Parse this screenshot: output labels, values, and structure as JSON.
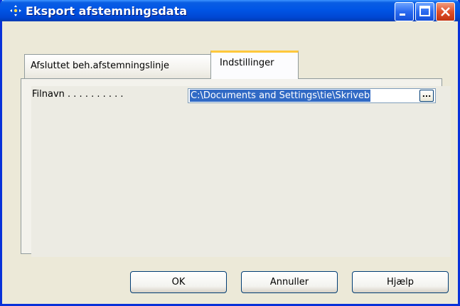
{
  "window": {
    "title": "Eksport afstemningsdata",
    "icon": "move-arrows-icon",
    "controls": [
      "minimize-icon",
      "maximize-icon",
      "close-icon"
    ]
  },
  "tabs": [
    {
      "label": "Afsluttet beh.afstemningslinje",
      "active": false
    },
    {
      "label": "Indstillinger",
      "active": true
    }
  ],
  "form": {
    "filename_label": "Filnavn . . . . . . . . . .",
    "filename_value": "C:\\Documents and Settings\\tie\\Skriveb",
    "browse_label": "..."
  },
  "buttons": {
    "ok": "OK",
    "cancel": "Annuller",
    "help": "Hjælp"
  },
  "colors": {
    "titlebar": "#0055e5",
    "active_tab_highlight": "#ffc83c",
    "selection": "#316ac5",
    "close_button": "#e0502a"
  }
}
